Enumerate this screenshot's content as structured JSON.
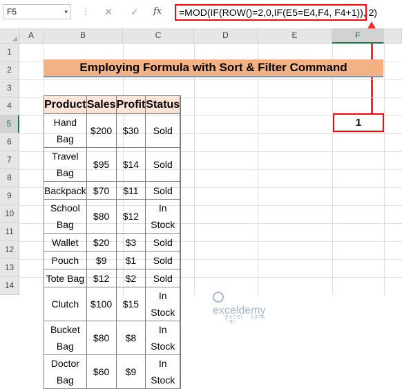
{
  "formula_bar": {
    "name_box": "F5",
    "name_box_arrow": "▾",
    "dots": "⋮",
    "cancel_icon": "✕",
    "enter_icon": "✓",
    "fx": "fx",
    "formula": "=MOD(IF(ROW()=2,0,IF(E5=E4,F4, F4+1)), 2)"
  },
  "columns": [
    "A",
    "B",
    "C",
    "D",
    "E",
    "F"
  ],
  "rows": [
    "1",
    "2",
    "3",
    "4",
    "5",
    "6",
    "7",
    "8",
    "9",
    "10",
    "11",
    "12",
    "13",
    "14"
  ],
  "selected_cell": {
    "column": "F",
    "row": "5"
  },
  "sheet": {
    "title": "Employing Formula with Sort & Filter Command",
    "headers": [
      "Product",
      "Sales",
      "Profit",
      "Status",
      ""
    ],
    "data": [
      [
        "Hand Bag",
        "$200",
        "$30",
        "Sold",
        "1"
      ],
      [
        "Travel Bag",
        "$95",
        "$14",
        "Sold",
        ""
      ],
      [
        "Backpack",
        "$70",
        "$11",
        "Sold",
        ""
      ],
      [
        "School Bag",
        "$80",
        "$12",
        "In Stock",
        ""
      ],
      [
        "Wallet",
        "$20",
        "$3",
        "Sold",
        ""
      ],
      [
        "Pouch",
        "$9",
        "$1",
        "Sold",
        ""
      ],
      [
        "Tote Bag",
        "$12",
        "$2",
        "Sold",
        ""
      ],
      [
        "Clutch",
        "$100",
        "$15",
        "In Stock",
        ""
      ],
      [
        "Bucket Bag",
        "$80",
        "$8",
        "In Stock",
        ""
      ],
      [
        "Doctor Bag",
        "$60",
        "$9",
        "In Stock",
        ""
      ]
    ]
  },
  "watermark": {
    "name": "exceldemy",
    "tagline": "EXCEL · DATA · BI"
  },
  "colors": {
    "title_fill": "#f4b183",
    "header_fill": "#fce4d6",
    "highlight": "#ff0000",
    "select_green": "#217346"
  }
}
